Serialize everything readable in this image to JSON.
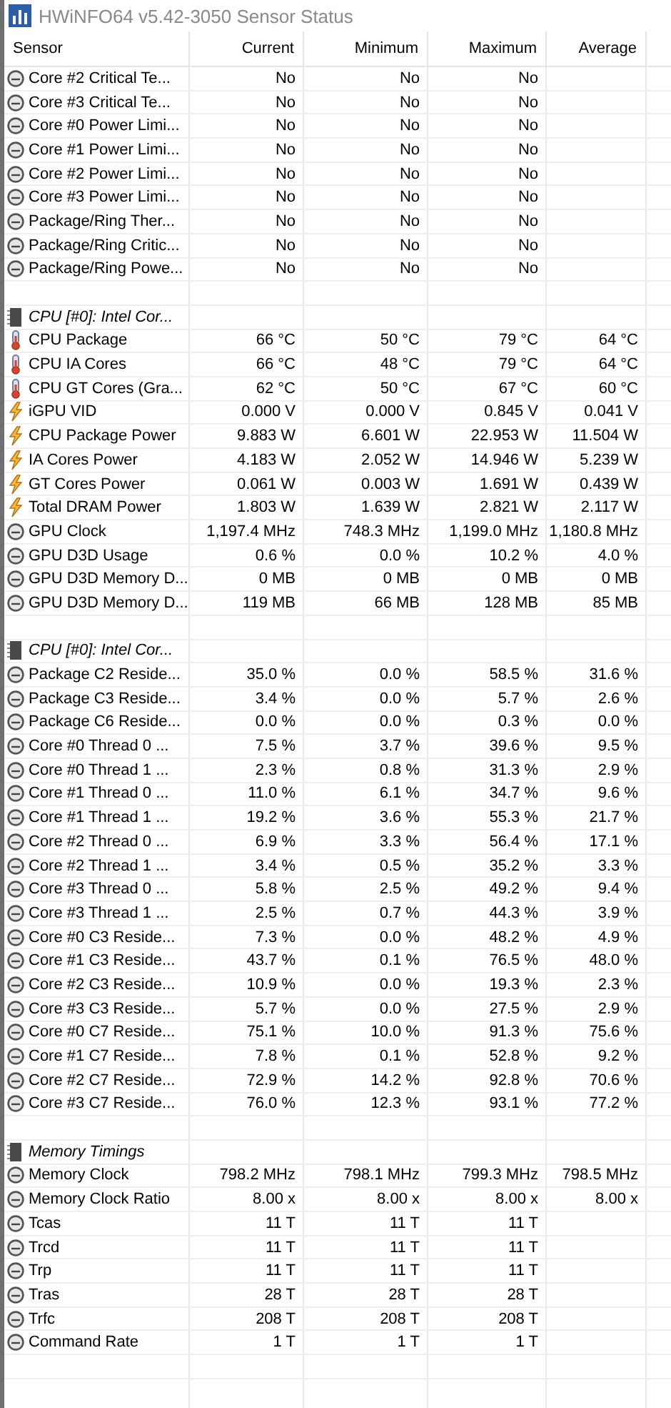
{
  "window": {
    "title": "HWiNFO64 v5.42-3050 Sensor Status"
  },
  "columns": [
    "Sensor",
    "Current",
    "Minimum",
    "Maximum",
    "Average"
  ],
  "rows": [
    {
      "kind": "status",
      "name": "Core #2 Critical Te...",
      "values": [
        "No",
        "No",
        "No"
      ]
    },
    {
      "kind": "status",
      "name": "Core #3 Critical Te...",
      "values": [
        "No",
        "No",
        "No"
      ]
    },
    {
      "kind": "status",
      "name": "Core #0 Power Limi...",
      "values": [
        "No",
        "No",
        "No"
      ]
    },
    {
      "kind": "status",
      "name": "Core #1 Power Limi...",
      "values": [
        "No",
        "No",
        "No"
      ]
    },
    {
      "kind": "status",
      "name": "Core #2 Power Limi...",
      "values": [
        "No",
        "No",
        "No"
      ]
    },
    {
      "kind": "status",
      "name": "Core #3 Power Limi...",
      "values": [
        "No",
        "No",
        "No"
      ]
    },
    {
      "kind": "status",
      "name": "Package/Ring Ther...",
      "values": [
        "No",
        "No",
        "No"
      ]
    },
    {
      "kind": "status",
      "name": "Package/Ring Critic...",
      "values": [
        "No",
        "No",
        "No"
      ]
    },
    {
      "kind": "status",
      "name": "Package/Ring Powe...",
      "values": [
        "No",
        "No",
        "No"
      ]
    },
    {
      "kind": "blank"
    },
    {
      "kind": "group",
      "name": "CPU [#0]: Intel Cor..."
    },
    {
      "kind": "temperature",
      "name": "CPU Package",
      "values": [
        "66 °C",
        "50 °C",
        "79 °C",
        "64 °C"
      ]
    },
    {
      "kind": "temperature",
      "name": "CPU IA Cores",
      "values": [
        "66 °C",
        "48 °C",
        "79 °C",
        "64 °C"
      ]
    },
    {
      "kind": "temperature",
      "name": "CPU GT Cores (Gra...",
      "values": [
        "62 °C",
        "50 °C",
        "67 °C",
        "60 °C"
      ]
    },
    {
      "kind": "power",
      "name": "iGPU VID",
      "values": [
        "0.000 V",
        "0.000 V",
        "0.845 V",
        "0.041 V"
      ]
    },
    {
      "kind": "power",
      "name": "CPU Package Power",
      "values": [
        "9.883 W",
        "6.601 W",
        "22.953 W",
        "11.504 W"
      ]
    },
    {
      "kind": "power",
      "name": "IA Cores Power",
      "values": [
        "4.183 W",
        "2.052 W",
        "14.946 W",
        "5.239 W"
      ]
    },
    {
      "kind": "power",
      "name": "GT Cores Power",
      "values": [
        "0.061 W",
        "0.003 W",
        "1.691 W",
        "0.439 W"
      ]
    },
    {
      "kind": "power",
      "name": "Total DRAM Power",
      "values": [
        "1.803 W",
        "1.639 W",
        "2.821 W",
        "2.117 W"
      ]
    },
    {
      "kind": "status",
      "name": "GPU Clock",
      "values": [
        "1,197.4 MHz",
        "748.3 MHz",
        "1,199.0 MHz",
        "1,180.8 MHz"
      ]
    },
    {
      "kind": "status",
      "name": "GPU D3D Usage",
      "values": [
        "0.6 %",
        "0.0 %",
        "10.2 %",
        "4.0 %"
      ]
    },
    {
      "kind": "status",
      "name": "GPU D3D Memory D...",
      "values": [
        "0 MB",
        "0 MB",
        "0 MB",
        "0 MB"
      ]
    },
    {
      "kind": "status",
      "name": "GPU D3D Memory D...",
      "values": [
        "119 MB",
        "66 MB",
        "128 MB",
        "85 MB"
      ]
    },
    {
      "kind": "blank"
    },
    {
      "kind": "group",
      "name": "CPU [#0]: Intel Cor..."
    },
    {
      "kind": "status",
      "name": "Package C2 Reside...",
      "values": [
        "35.0 %",
        "0.0 %",
        "58.5 %",
        "31.6 %"
      ]
    },
    {
      "kind": "status",
      "name": "Package C3 Reside...",
      "values": [
        "3.4 %",
        "0.0 %",
        "5.7 %",
        "2.6 %"
      ]
    },
    {
      "kind": "status",
      "name": "Package C6 Reside...",
      "values": [
        "0.0 %",
        "0.0 %",
        "0.3 %",
        "0.0 %"
      ]
    },
    {
      "kind": "status",
      "name": "Core #0 Thread 0 ...",
      "values": [
        "7.5 %",
        "3.7 %",
        "39.6 %",
        "9.5 %"
      ]
    },
    {
      "kind": "status",
      "name": "Core #0 Thread 1 ...",
      "values": [
        "2.3 %",
        "0.8 %",
        "31.3 %",
        "2.9 %"
      ]
    },
    {
      "kind": "status",
      "name": "Core #1 Thread 0 ...",
      "values": [
        "11.0 %",
        "6.1 %",
        "34.7 %",
        "9.6 %"
      ]
    },
    {
      "kind": "status",
      "name": "Core #1 Thread 1 ...",
      "values": [
        "19.2 %",
        "3.6 %",
        "55.3 %",
        "21.7 %"
      ]
    },
    {
      "kind": "status",
      "name": "Core #2 Thread 0 ...",
      "values": [
        "6.9 %",
        "3.3 %",
        "56.4 %",
        "17.1 %"
      ]
    },
    {
      "kind": "status",
      "name": "Core #2 Thread 1 ...",
      "values": [
        "3.4 %",
        "0.5 %",
        "35.2 %",
        "3.3 %"
      ]
    },
    {
      "kind": "status",
      "name": "Core #3 Thread 0 ...",
      "values": [
        "5.8 %",
        "2.5 %",
        "49.2 %",
        "9.4 %"
      ]
    },
    {
      "kind": "status",
      "name": "Core #3 Thread 1 ...",
      "values": [
        "2.5 %",
        "0.7 %",
        "44.3 %",
        "3.9 %"
      ]
    },
    {
      "kind": "status",
      "name": "Core #0 C3 Reside...",
      "values": [
        "7.3 %",
        "0.0 %",
        "48.2 %",
        "4.9 %"
      ]
    },
    {
      "kind": "status",
      "name": "Core #1 C3 Reside...",
      "values": [
        "43.7 %",
        "0.1 %",
        "76.5 %",
        "48.0 %"
      ]
    },
    {
      "kind": "status",
      "name": "Core #2 C3 Reside...",
      "values": [
        "10.9 %",
        "0.0 %",
        "19.3 %",
        "2.3 %"
      ]
    },
    {
      "kind": "status",
      "name": "Core #3 C3 Reside...",
      "values": [
        "5.7 %",
        "0.0 %",
        "27.5 %",
        "2.9 %"
      ]
    },
    {
      "kind": "status",
      "name": "Core #0 C7 Reside...",
      "values": [
        "75.1 %",
        "10.0 %",
        "91.3 %",
        "75.6 %"
      ]
    },
    {
      "kind": "status",
      "name": "Core #1 C7 Reside...",
      "values": [
        "7.8 %",
        "0.1 %",
        "52.8 %",
        "9.2 %"
      ]
    },
    {
      "kind": "status",
      "name": "Core #2 C7 Reside...",
      "values": [
        "72.9 %",
        "14.2 %",
        "92.8 %",
        "70.6 %"
      ]
    },
    {
      "kind": "status",
      "name": "Core #3 C7 Reside...",
      "values": [
        "76.0 %",
        "12.3 %",
        "93.1 %",
        "77.2 %"
      ]
    },
    {
      "kind": "blank"
    },
    {
      "kind": "group",
      "name": "Memory Timings"
    },
    {
      "kind": "status",
      "name": "Memory Clock",
      "values": [
        "798.2 MHz",
        "798.1 MHz",
        "799.3 MHz",
        "798.5 MHz"
      ]
    },
    {
      "kind": "status",
      "name": "Memory Clock Ratio",
      "values": [
        "8.00 x",
        "8.00 x",
        "8.00 x",
        "8.00 x"
      ]
    },
    {
      "kind": "status",
      "name": "Tcas",
      "values": [
        "11 T",
        "11 T",
        "11 T"
      ]
    },
    {
      "kind": "status",
      "name": "Trcd",
      "values": [
        "11 T",
        "11 T",
        "11 T"
      ]
    },
    {
      "kind": "status",
      "name": "Trp",
      "values": [
        "11 T",
        "11 T",
        "11 T"
      ]
    },
    {
      "kind": "status",
      "name": "Tras",
      "values": [
        "28 T",
        "28 T",
        "28 T"
      ]
    },
    {
      "kind": "status",
      "name": "Trfc",
      "values": [
        "208 T",
        "208 T",
        "208 T"
      ]
    },
    {
      "kind": "status",
      "name": "Command Rate",
      "values": [
        "1 T",
        "1 T",
        "1 T"
      ]
    },
    {
      "kind": "blank"
    }
  ]
}
